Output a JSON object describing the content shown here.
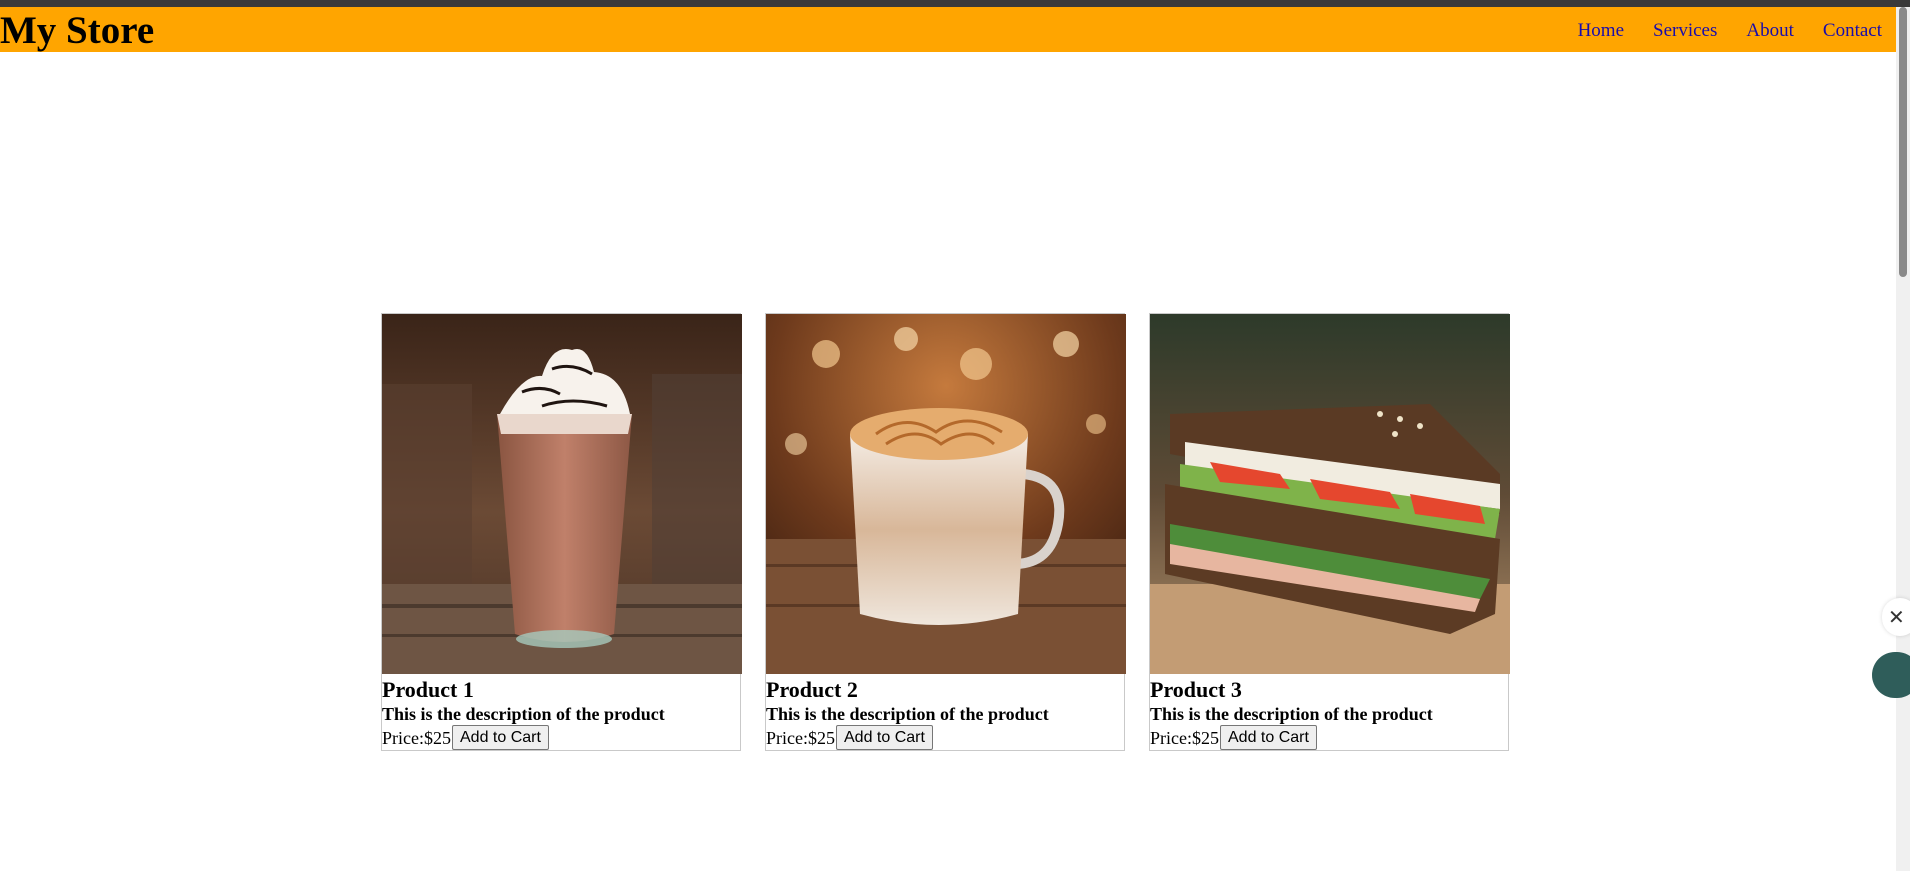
{
  "header": {
    "brand": "My Store",
    "nav": [
      "Home",
      "Services",
      "About",
      "Contact"
    ],
    "background_color": "#ffa500",
    "link_color": "#1a0dab"
  },
  "products": [
    {
      "title": "Product 1",
      "description": "This is the description of the product",
      "price": "Price:$25",
      "button": "Add to Cart",
      "image": "frappe-drink-image"
    },
    {
      "title": "Product 2",
      "description": "This is the description of the product",
      "price": "Price:$25",
      "button": "Add to Cart",
      "image": "latte-cup-image"
    },
    {
      "title": "Product 3",
      "description": "This is the description of the product",
      "price": "Price:$25",
      "button": "Add to Cart",
      "image": "sandwich-image"
    }
  ],
  "widgets": {
    "close_icon": "close-icon",
    "chat_icon": "chat-bubble-icon"
  }
}
